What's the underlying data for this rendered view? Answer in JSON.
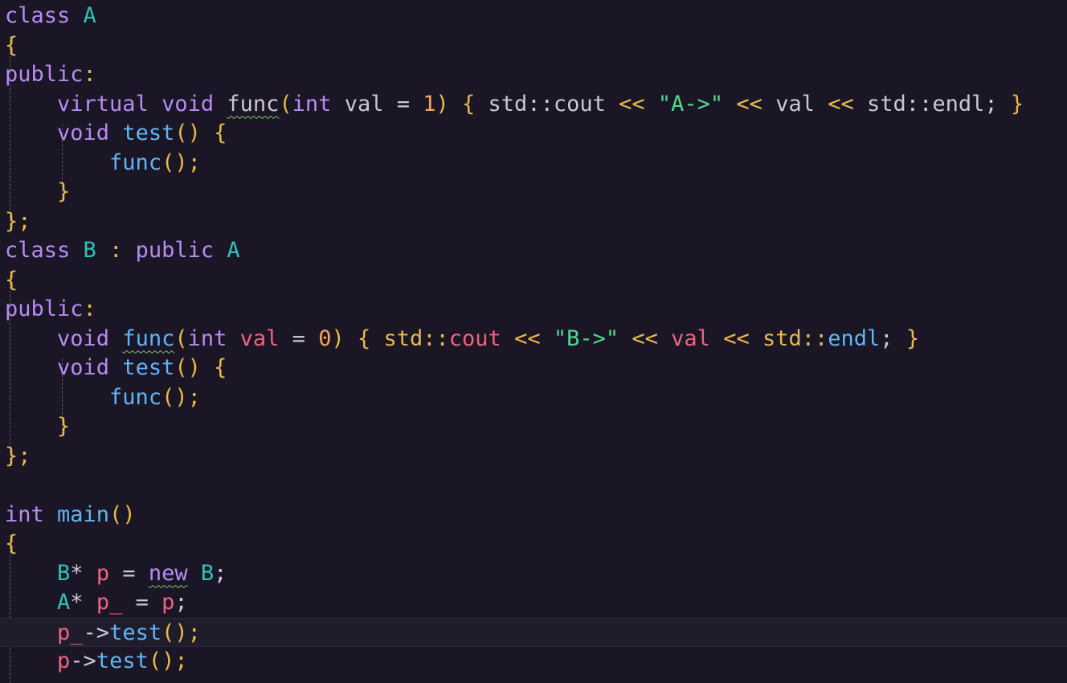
{
  "colors": {
    "background": "#1a1625",
    "current_line": "#1f1c2c",
    "keyword": "#b68cf2",
    "type": "#2ec4b6",
    "function": "#61b4f6",
    "variable": "#f0637c",
    "plain": "#c9c7d8",
    "string": "#4ed98c",
    "number": "#f6a65a",
    "punct": "#e9b949",
    "squiggle": "#7fc96a"
  },
  "lines": [
    {
      "fold": true,
      "tokens": [
        [
          "class ",
          "keyword"
        ],
        [
          "A",
          "type"
        ]
      ]
    },
    {
      "tokens": [
        [
          "{",
          "punct"
        ]
      ]
    },
    {
      "tokens": [
        [
          "public",
          "keyword"
        ],
        [
          ":",
          "punct"
        ]
      ]
    },
    {
      "tokens": [
        [
          "    ",
          "plain"
        ],
        [
          "virtual ",
          "keyword"
        ],
        [
          "void ",
          "keyword"
        ],
        [
          "func",
          "plain",
          "squiggle"
        ],
        [
          "(",
          "punct"
        ],
        [
          "int ",
          "keyword"
        ],
        [
          "val ",
          "plain"
        ],
        [
          "= ",
          "plain"
        ],
        [
          "1",
          "number"
        ],
        [
          ") ",
          "punct"
        ],
        [
          "{ ",
          "punct"
        ],
        [
          "std",
          "plain"
        ],
        [
          "::",
          "plain"
        ],
        [
          "cout ",
          "plain"
        ],
        [
          "<< ",
          "punct"
        ],
        [
          "\"A->\"",
          "string"
        ],
        [
          " << ",
          "punct"
        ],
        [
          "val ",
          "plain"
        ],
        [
          "<< ",
          "punct"
        ],
        [
          "std",
          "plain"
        ],
        [
          "::",
          "plain"
        ],
        [
          "endl",
          "plain"
        ],
        [
          "; ",
          "plain"
        ],
        [
          "}",
          "punct"
        ]
      ]
    },
    {
      "tokens": [
        [
          "    ",
          "plain"
        ],
        [
          "void ",
          "keyword"
        ],
        [
          "test",
          "function"
        ],
        [
          "() ",
          "punct"
        ],
        [
          "{",
          "punct"
        ]
      ]
    },
    {
      "tokens": [
        [
          "        ",
          "plain"
        ],
        [
          "func",
          "function"
        ],
        [
          "();",
          "punct"
        ]
      ]
    },
    {
      "tokens": [
        [
          "    ",
          "plain"
        ],
        [
          "}",
          "punct"
        ]
      ]
    },
    {
      "tokens": [
        [
          "};",
          "punct"
        ]
      ]
    },
    {
      "fold": true,
      "tokens": [
        [
          "class ",
          "keyword"
        ],
        [
          "B ",
          "type"
        ],
        [
          ": ",
          "punct"
        ],
        [
          "public ",
          "keyword"
        ],
        [
          "A",
          "type"
        ]
      ]
    },
    {
      "tokens": [
        [
          "{",
          "punct"
        ]
      ]
    },
    {
      "tokens": [
        [
          "public",
          "keyword"
        ],
        [
          ":",
          "punct"
        ]
      ]
    },
    {
      "tokens": [
        [
          "    ",
          "plain"
        ],
        [
          "void ",
          "keyword"
        ],
        [
          "func",
          "function",
          "squiggle"
        ],
        [
          "(",
          "punct"
        ],
        [
          "int ",
          "keyword"
        ],
        [
          "val ",
          "variable"
        ],
        [
          "= ",
          "plain"
        ],
        [
          "0",
          "number"
        ],
        [
          ") ",
          "punct"
        ],
        [
          "{ ",
          "punct"
        ],
        [
          "std",
          "punct"
        ],
        [
          "::",
          "punct"
        ],
        [
          "cout ",
          "variable"
        ],
        [
          "<< ",
          "punct"
        ],
        [
          "\"B->\"",
          "string"
        ],
        [
          " << ",
          "punct"
        ],
        [
          "val ",
          "variable"
        ],
        [
          "<< ",
          "punct"
        ],
        [
          "std",
          "punct"
        ],
        [
          "::",
          "punct"
        ],
        [
          "endl",
          "function"
        ],
        [
          "; ",
          "plain"
        ],
        [
          "}",
          "punct"
        ]
      ]
    },
    {
      "tokens": [
        [
          "    ",
          "plain"
        ],
        [
          "void ",
          "keyword"
        ],
        [
          "test",
          "function"
        ],
        [
          "() ",
          "punct"
        ],
        [
          "{",
          "punct"
        ]
      ]
    },
    {
      "tokens": [
        [
          "        ",
          "plain"
        ],
        [
          "func",
          "function"
        ],
        [
          "();",
          "punct"
        ]
      ]
    },
    {
      "tokens": [
        [
          "    ",
          "plain"
        ],
        [
          "}",
          "punct"
        ]
      ]
    },
    {
      "tokens": [
        [
          "};",
          "punct"
        ]
      ]
    },
    {
      "tokens": []
    },
    {
      "fold": true,
      "tokens": [
        [
          "int ",
          "keyword"
        ],
        [
          "main",
          "function"
        ],
        [
          "()",
          "punct"
        ]
      ]
    },
    {
      "tokens": [
        [
          "{",
          "punct"
        ]
      ]
    },
    {
      "tokens": [
        [
          "    ",
          "plain"
        ],
        [
          "B",
          "type"
        ],
        [
          "* ",
          "plain"
        ],
        [
          "p ",
          "variable"
        ],
        [
          "= ",
          "plain"
        ],
        [
          "new",
          "keyword",
          "squiggle"
        ],
        [
          " ",
          "plain"
        ],
        [
          "B",
          "type"
        ],
        [
          ";",
          "plain"
        ]
      ]
    },
    {
      "tokens": [
        [
          "    ",
          "plain"
        ],
        [
          "A",
          "type"
        ],
        [
          "* ",
          "plain"
        ],
        [
          "p_ ",
          "variable"
        ],
        [
          "= ",
          "plain"
        ],
        [
          "p",
          "variable"
        ],
        [
          ";",
          "plain"
        ]
      ]
    },
    {
      "current": true,
      "tokens": [
        [
          "    ",
          "plain"
        ],
        [
          "p_",
          "variable"
        ],
        [
          "->",
          "plain"
        ],
        [
          "test",
          "function"
        ],
        [
          "();",
          "punct"
        ]
      ]
    },
    {
      "tokens": [
        [
          "    ",
          "plain"
        ],
        [
          "p",
          "variable"
        ],
        [
          "->",
          "plain"
        ],
        [
          "test",
          "function"
        ],
        [
          "();",
          "punct"
        ]
      ]
    }
  ]
}
